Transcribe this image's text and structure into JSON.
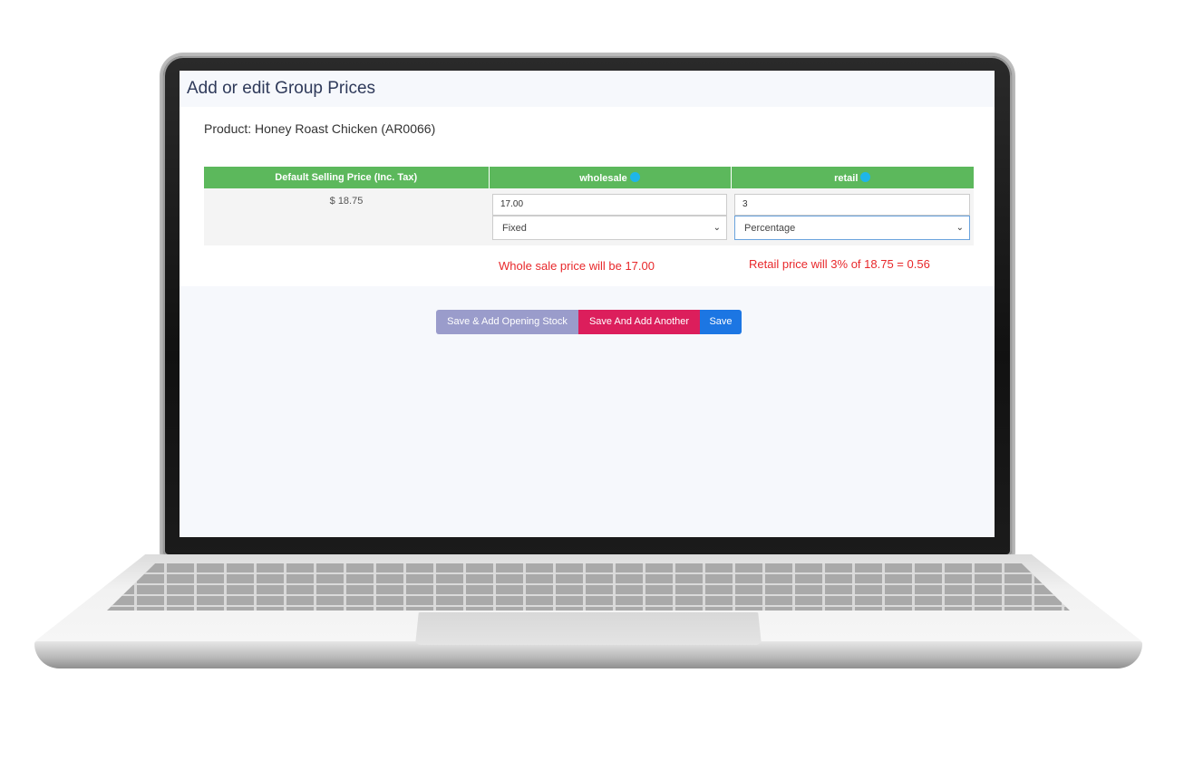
{
  "page": {
    "title": "Add or edit Group Prices",
    "product_label": "Product: Honey Roast Chicken (AR0066)"
  },
  "table": {
    "headers": [
      "Default Selling Price (Inc. Tax)",
      "wholesale",
      "retail"
    ],
    "default_price": "$ 18.75",
    "wholesale": {
      "value": "17.00",
      "type": "Fixed",
      "hint": "Whole sale price will be 17.00"
    },
    "retail": {
      "value": "3",
      "type": "Percentage",
      "hint": "Retail price will 3% of 18.75 = 0.56"
    }
  },
  "buttons": {
    "opening_stock": "Save & Add Opening Stock",
    "add_another": "Save And Add Another",
    "save": "Save"
  },
  "colors": {
    "header_green": "#5cb85c",
    "hint_red": "#e8282b",
    "btn_opening": "#9a9ccb",
    "btn_another": "#dc1e5c",
    "btn_save": "#1c76e3"
  },
  "icons": {
    "info": "info-icon",
    "chevron": "chevron-down-icon"
  }
}
